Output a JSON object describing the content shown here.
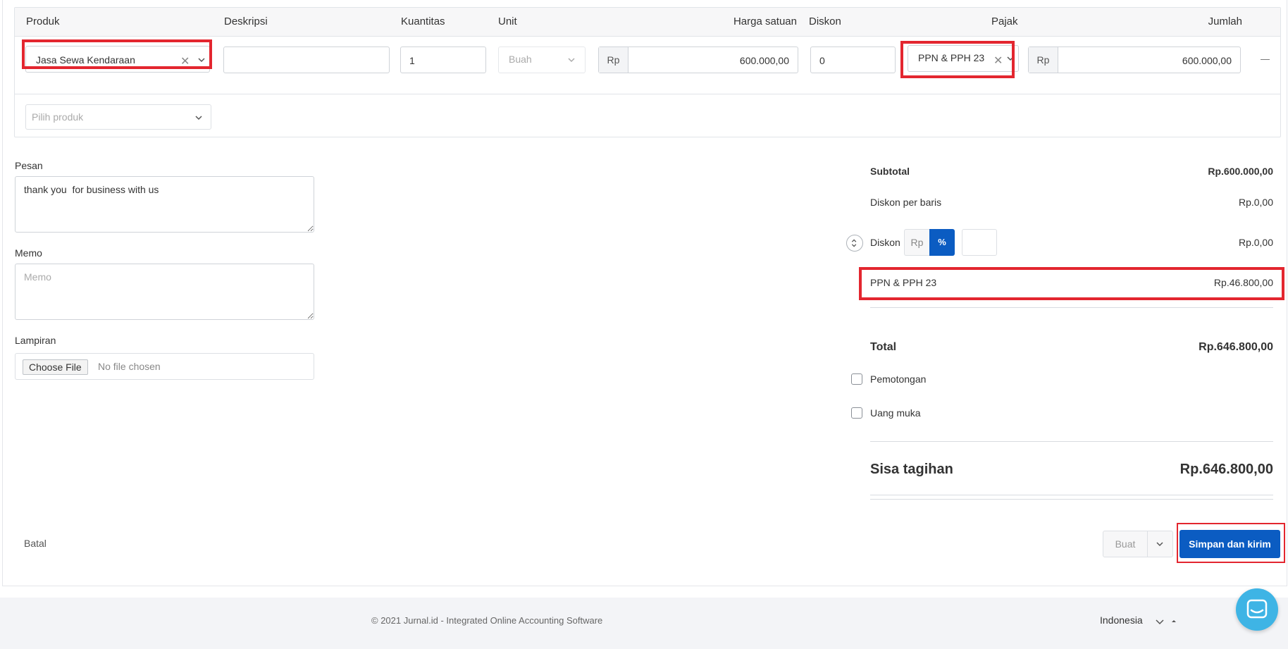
{
  "table": {
    "headers": {
      "produk": "Produk",
      "deskripsi": "Deskripsi",
      "kuantitas": "Kuantitas",
      "unit": "Unit",
      "harga_satuan": "Harga satuan",
      "diskon": "Diskon",
      "pajak": "Pajak",
      "jumlah": "Jumlah"
    },
    "row": {
      "produk": "Jasa Sewa Kendaraan",
      "deskripsi": "",
      "kuantitas": "1",
      "unit": "Buah",
      "currency": "Rp",
      "harga_satuan": "600.000,00",
      "diskon": "0",
      "pajak": "PPN & PPH 23",
      "jumlah": "600.000,00",
      "remove": "—"
    },
    "add_product_placeholder": "Pilih produk"
  },
  "left": {
    "pesan_label": "Pesan",
    "pesan_value": "thank you  for business with us",
    "memo_label": "Memo",
    "memo_placeholder": "Memo",
    "lampiran_label": "Lampiran",
    "choose_file": "Choose File",
    "no_file": "No file chosen"
  },
  "summary": {
    "subtotal_label": "Subtotal",
    "subtotal_value": "Rp.600.000,00",
    "diskon_baris_label": "Diskon per baris",
    "diskon_baris_value": "Rp.0,00",
    "diskon_label": "Diskon",
    "diskon_rp": "Rp",
    "diskon_pct": "%",
    "diskon_value": "Rp.0,00",
    "tax_label": "PPN & PPH 23",
    "tax_value": "Rp.46.800,00",
    "total_label": "Total",
    "total_value": "Rp.646.800,00",
    "pemotongan_label": "Pemotongan",
    "uang_muka_label": "Uang muka",
    "sisa_label": "Sisa tagihan",
    "sisa_value": "Rp.646.800,00"
  },
  "actions": {
    "batal": "Batal",
    "buat": "Buat",
    "simpan": "Simpan dan kirim"
  },
  "footer": {
    "copyright": "© 2021 Jurnal.id - Integrated Online Accounting Software",
    "language": "Indonesia"
  },
  "colors": {
    "primary": "#0b5cc2",
    "highlight": "#e3262f"
  }
}
